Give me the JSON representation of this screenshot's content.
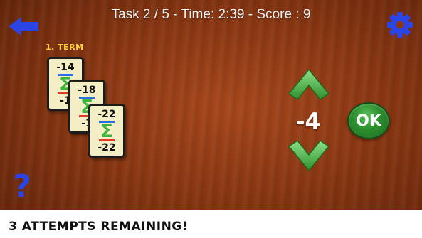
{
  "header": {
    "text": "Task 2 / 5  -  Time: 2:39  -  Score : 9"
  },
  "buttons": {
    "back_icon": "back-arrow-icon",
    "settings_icon": "gear-icon",
    "help_label": "?",
    "ok_label": "OK"
  },
  "term_label": "1. TERM",
  "cards": [
    {
      "top": "-14",
      "bottom": "-1"
    },
    {
      "top": "-18",
      "bottom": "-1"
    },
    {
      "top": "-22",
      "bottom": "-22"
    }
  ],
  "stepper": {
    "value": "-4"
  },
  "status": {
    "text": "3 ATTEMPTS REMAINING!"
  },
  "colors": {
    "accent_blue": "#2b44e6",
    "accent_green": "#3bb53b",
    "label_yellow": "#ffd23a"
  }
}
